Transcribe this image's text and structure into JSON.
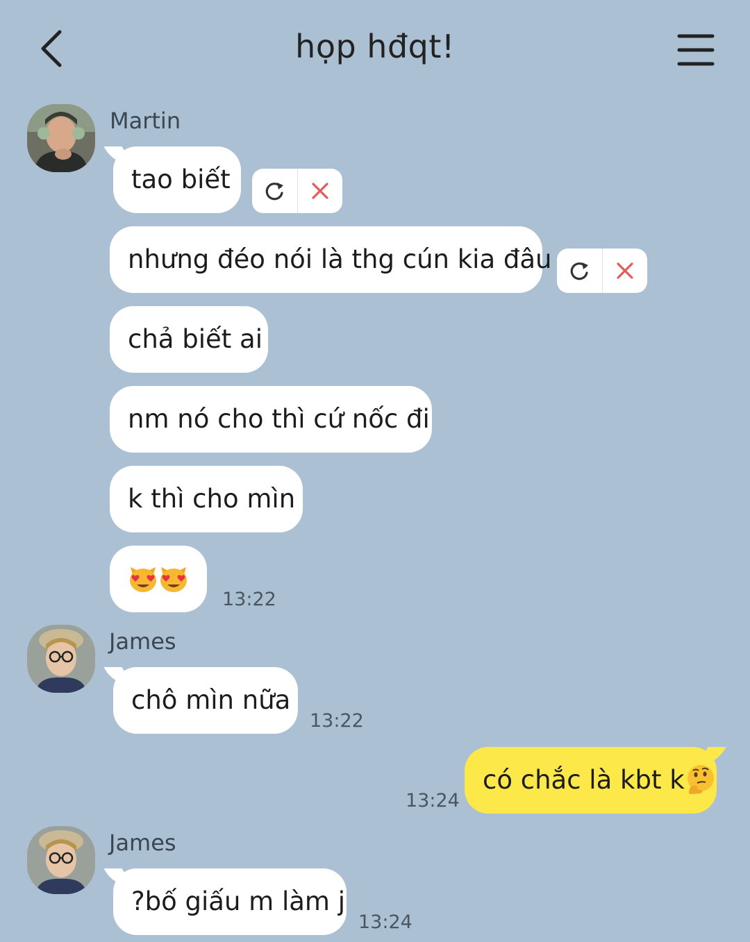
{
  "header": {
    "title": "họp hđqt!",
    "back_icon": "chevron-left-icon",
    "menu_icon": "hamburger-menu-icon"
  },
  "messages": [
    {
      "sender": "Martin",
      "text": "tao biết",
      "failed": true
    },
    {
      "sender": "Martin",
      "text": "nhưng đéo nói là thg cún kia đâu",
      "failed": true
    },
    {
      "sender": "Martin",
      "text": "chả biết ai"
    },
    {
      "sender": "Martin",
      "text": "nm nó cho thì cứ nốc đi"
    },
    {
      "sender": "Martin",
      "text": "k thì cho mìn"
    },
    {
      "sender": "Martin",
      "text": "",
      "emoji": [
        "heart-eyes-cat-emoji",
        "heart-eyes-cat-emoji"
      ],
      "time": "13:22"
    },
    {
      "sender": "James",
      "text": "chô mìn nữa",
      "time": "13:22"
    },
    {
      "sender": "me",
      "text": "có chắc là kbt k",
      "emoji": [
        "thinking-face-emoji"
      ],
      "time": "13:24"
    },
    {
      "sender": "James",
      "text": "?bố giấu m làm j",
      "time": "13:24"
    }
  ],
  "colors": {
    "background": "#abc1d3",
    "incoming_bubble": "#ffffff",
    "outgoing_bubble": "#fde84a",
    "delete_icon": "#e5595a"
  },
  "icons": {
    "resend": "refresh-icon",
    "delete": "close-icon"
  }
}
